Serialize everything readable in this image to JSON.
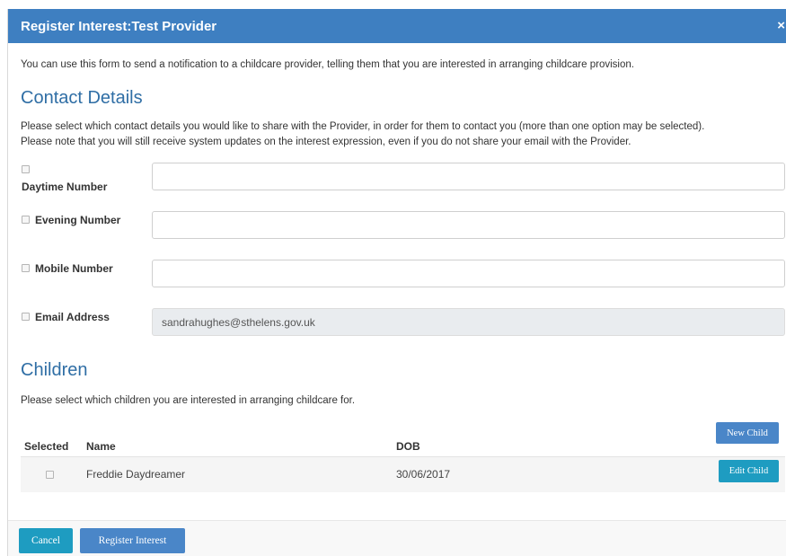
{
  "header": {
    "title": "Register Interest:Test Provider",
    "close_glyph": "×"
  },
  "intro": "You can use this form to send a notification to a childcare provider, telling them that you are interested in arranging childcare provision.",
  "contact": {
    "title": "Contact Details",
    "help_line1": "Please select which contact details you would like to share with the Provider, in order for them to contact you (more than one option may be selected).",
    "help_line2": "Please note that you will still receive system updates on the interest expression, even if you do not share your email with the Provider.",
    "fields": [
      {
        "label": "Daytime Number",
        "value": "",
        "checked": false
      },
      {
        "label": "Evening Number",
        "value": "",
        "checked": false
      },
      {
        "label": "Mobile Number",
        "value": "",
        "checked": false
      },
      {
        "label": "Email Address",
        "value": "sandrahughes@sthelens.gov.uk",
        "checked": false
      }
    ]
  },
  "children": {
    "title": "Children",
    "help": "Please select which children you are interested in arranging childcare for.",
    "columns": {
      "selected": "Selected",
      "name": "Name",
      "dob": "DOB"
    },
    "new_child_label": "New Child",
    "rows": [
      {
        "name": "Freddie Daydreamer",
        "dob": "30/06/2017",
        "checked": false,
        "edit_label": "Edit Child"
      }
    ]
  },
  "footer": {
    "cancel_label": "Cancel",
    "register_label": "Register Interest"
  },
  "colors": {
    "header": "#3e7fc1",
    "section_title": "#2f6ea5",
    "primary": "#4a86c8",
    "info": "#1e9cc1"
  }
}
